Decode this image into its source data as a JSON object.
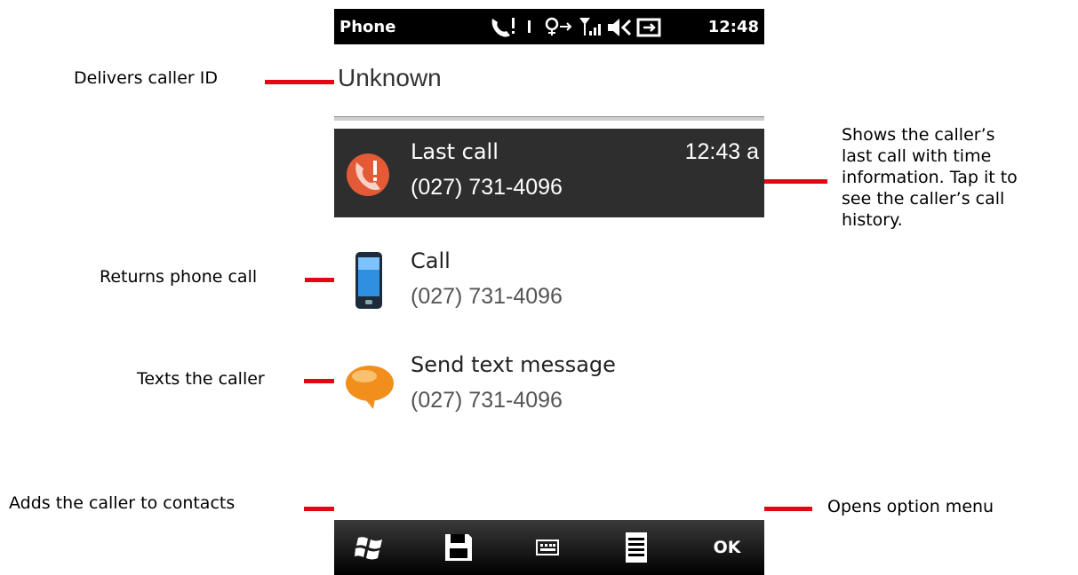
{
  "status_bar": {
    "app_title": "Phone",
    "time": "12:48"
  },
  "caller_id": "Unknown",
  "rows": [
    {
      "title": "Last call",
      "number": "(027) 731-4096",
      "time": "12:43 a",
      "icon": "missed-call-icon"
    },
    {
      "title": "Call",
      "number": "(027) 731-4096",
      "icon": "phone-icon"
    },
    {
      "title": "Send text message",
      "number": "(027) 731-4096",
      "icon": "speech-bubble-icon"
    }
  ],
  "softbar": {
    "ok_label": "OK",
    "icons": [
      "windows-start-icon",
      "save-icon",
      "keyboard-icon",
      "menu-icon"
    ]
  },
  "callouts": {
    "caller_id": "Delivers caller ID",
    "last_call": [
      "Shows the caller’s",
      "last call with time",
      "information. Tap it to",
      "see the caller’s call",
      "history."
    ],
    "call": "Returns phone call",
    "sms": "Texts the caller",
    "save": "Adds the caller to contacts",
    "menu": "Opens option menu"
  },
  "colors": {
    "callout_line": "#e30613",
    "selected_row": "#2e2e2e"
  }
}
